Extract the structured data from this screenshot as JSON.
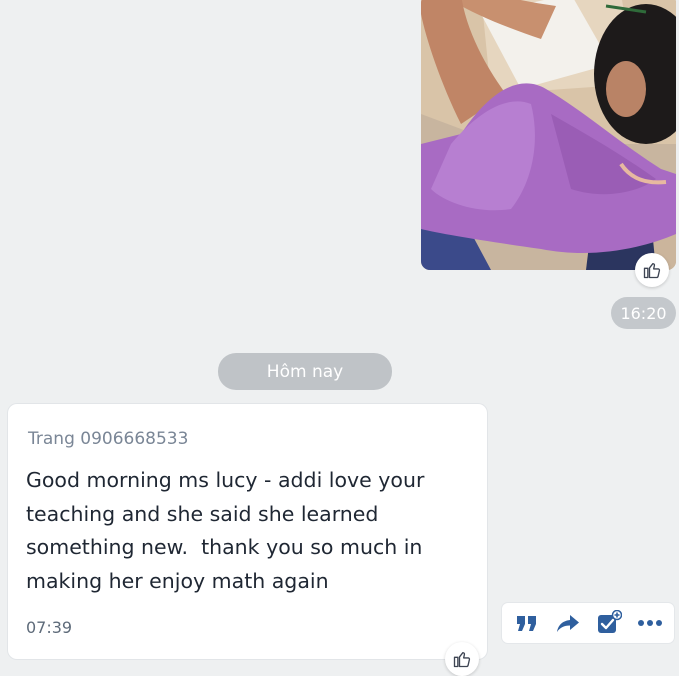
{
  "conversation": {
    "photo_message": {
      "time": "16:20"
    },
    "date_divider": "Hôm nay",
    "text_message": {
      "sender": "Trang 0906668533",
      "body": "Good morning ms lucy - addi love your teaching and she said she learned something new.  thank you so much in making her enjoy math again",
      "time": "07:39"
    }
  },
  "icons": {
    "like": "thumbs-up-icon",
    "quote": "quote-icon",
    "forward": "forward-arrow-icon",
    "task": "task-check-icon",
    "more": "more-dots-icon"
  },
  "colors": {
    "background": "#eef0f1",
    "action_icon": "#2f5f9e",
    "pill": "#bfc3c7"
  }
}
